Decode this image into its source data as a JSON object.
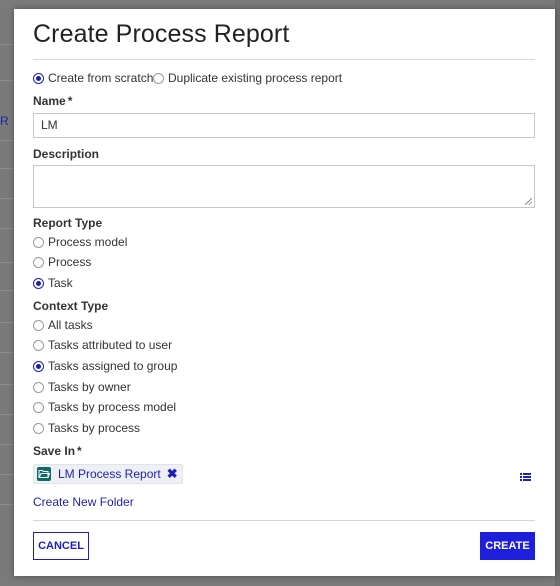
{
  "background": {
    "partial_link": "R"
  },
  "dialog": {
    "title": "Create Process Report",
    "mode_options": [
      {
        "label": "Create from scratch",
        "selected": true
      },
      {
        "label": "Duplicate existing process report",
        "selected": false
      }
    ],
    "name": {
      "label": "Name",
      "required_mark": "*",
      "value": "LM"
    },
    "description": {
      "label": "Description",
      "value": ""
    },
    "report_type": {
      "label": "Report Type",
      "options": [
        {
          "label": "Process model",
          "selected": false
        },
        {
          "label": "Process",
          "selected": false
        },
        {
          "label": "Task",
          "selected": true
        }
      ]
    },
    "context_type": {
      "label": "Context Type",
      "options": [
        {
          "label": "All tasks",
          "selected": false
        },
        {
          "label": "Tasks attributed to user",
          "selected": false
        },
        {
          "label": "Tasks assigned to group",
          "selected": true
        },
        {
          "label": "Tasks by owner",
          "selected": false
        },
        {
          "label": "Tasks by process model",
          "selected": false
        },
        {
          "label": "Tasks by process",
          "selected": false
        }
      ]
    },
    "save_in": {
      "label": "Save In",
      "required_mark": "*",
      "folder_name": "LM Process Report",
      "remove_glyph": "✖",
      "folder_icon": "folder-open-icon",
      "browse_icon": "list-icon"
    },
    "create_folder_link": "Create New Folder",
    "cancel_label": "CANCEL",
    "create_label": "CREATE"
  },
  "colors": {
    "accent": "#1d1fdb",
    "link": "#1d1fb8",
    "folder_icon_bg": "#0c6b6b",
    "overlay": "#777777"
  }
}
